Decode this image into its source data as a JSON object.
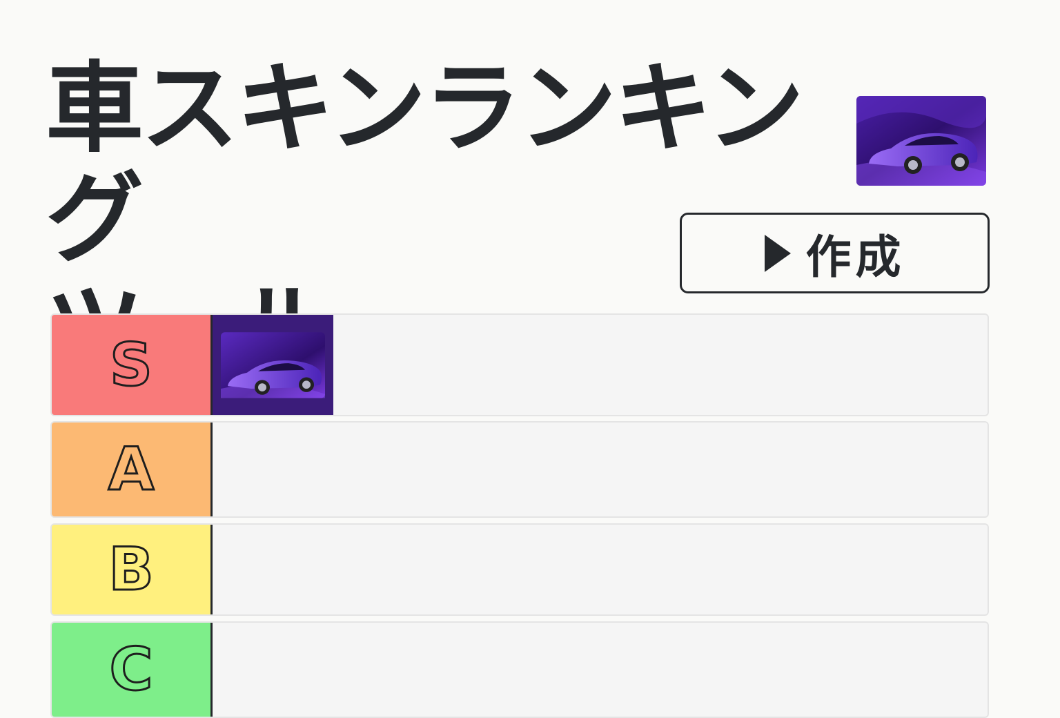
{
  "header": {
    "title": "車スキンランキング\nツール",
    "create_button": {
      "icon": "play-icon",
      "label": "作成"
    },
    "skin_thumbnail": {
      "kind": "car-skin",
      "colors": [
        "#6a2bd6",
        "#3b1c7a"
      ]
    }
  },
  "tiers": [
    {
      "label": "S",
      "color": "#f97a7a",
      "items": [
        {
          "kind": "car-skin",
          "colors": [
            "#6a2bd6",
            "#3b1c7a"
          ]
        }
      ]
    },
    {
      "label": "A",
      "color": "#fcb973",
      "items": []
    },
    {
      "label": "B",
      "color": "#fff07e",
      "items": []
    },
    {
      "label": "C",
      "color": "#7eee8a",
      "items": []
    }
  ]
}
